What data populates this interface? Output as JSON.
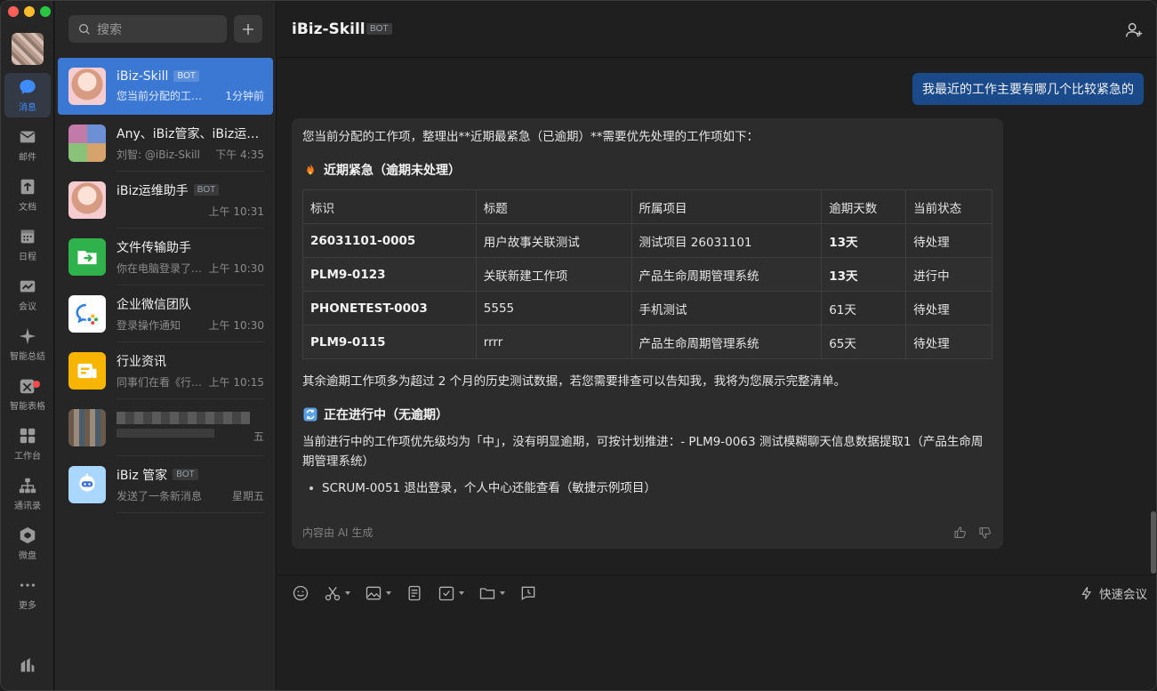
{
  "nav": {
    "items": [
      {
        "label": "消息",
        "icon": "chat-icon"
      },
      {
        "label": "邮件",
        "icon": "mail-icon"
      },
      {
        "label": "文档",
        "icon": "document-icon"
      },
      {
        "label": "日程",
        "icon": "calendar-icon"
      },
      {
        "label": "会议",
        "icon": "meeting-icon"
      },
      {
        "label": "智能总结",
        "icon": "sparkle-icon"
      },
      {
        "label": "智能表格",
        "icon": "smart-table-icon"
      },
      {
        "label": "工作台",
        "icon": "workbench-icon"
      },
      {
        "label": "通讯录",
        "icon": "contacts-icon"
      },
      {
        "label": "微盘",
        "icon": "drive-icon"
      },
      {
        "label": "更多",
        "icon": "more-icon"
      }
    ]
  },
  "search": {
    "placeholder": "搜索"
  },
  "conversations": [
    {
      "name": "iBiz-Skill",
      "badge": "BOT",
      "message": "您当前分配的工作项，整理出**近期最紧急（已逾期）**需要优先处理的工作项如下：",
      "time": "1分钟前",
      "active": true
    },
    {
      "name": "Any、iBiz管家、iBiz运维助手",
      "badge": "",
      "message": "刘智: @iBiz-Skill",
      "time": "下午 4:35"
    },
    {
      "name": "iBiz运维助手",
      "badge": "BOT",
      "message": "",
      "time": "上午 10:31"
    },
    {
      "name": "文件传输助手",
      "badge": "",
      "message": "你在电脑登录了企业微信",
      "time": "上午 10:30"
    },
    {
      "name": "企业微信团队",
      "badge": "",
      "message": "登录操作通知",
      "time": "上午 10:30"
    },
    {
      "name": "行业资讯",
      "badge": "",
      "message": "同事们在看《行业资讯》",
      "time": "上午 10:15"
    },
    {
      "name": "",
      "badge": "",
      "message": "",
      "time": "五"
    },
    {
      "name": "iBiz 管家",
      "badge": "BOT",
      "message": "发送了一条新消息",
      "time": "星期五"
    }
  ],
  "chat": {
    "title": "iBiz-Skill",
    "badge": "BOT",
    "user_message": "我最近的工作主要有哪几个比较紧急的",
    "intro": "您当前分配的工作项，整理出**近期最紧急（已逾期）**需要优先处理的工作项如下：",
    "section1_title": "近期紧急（逾期未处理）",
    "table": {
      "headers": [
        "标识",
        "标题",
        "所属项目",
        "逾期天数",
        "当前状态"
      ],
      "rows": [
        [
          "26031101-0005",
          "用户故事关联测试",
          "测试项目 26031101",
          "13天",
          "待处理"
        ],
        [
          "PLM9-0123",
          "关联新建工作项",
          "产品生命周期管理系统",
          "13天",
          "进行中"
        ],
        [
          "PHONETEST-0003",
          "5555",
          "手机测试",
          "61天",
          "待处理"
        ],
        [
          "PLM9-0115",
          "rrrr",
          "产品生命周期管理系统",
          "65天",
          "待处理"
        ]
      ]
    },
    "remaining_note": "其余逾期工作项多为超过 2 个月的历史测试数据，若您需要排查可以告知我，我将为您展示完整清单。",
    "section2_title": "正在进行中（无逾期）",
    "section2_text": "当前进行中的工作项优先级均为「中」，没有明显逾期，可按计划推进：- PLM9-0063 测试模糊聊天信息数据提取1（产品生命周期管理系统）",
    "section2_bullet": "SCRUM-0051 退出登录，个人中心还能查看（敏捷示例项目）",
    "ai_note": "内容由 AI 生成"
  },
  "composer": {
    "quick_meeting": "快速会议"
  },
  "colors": {
    "accent": "#3b78d4",
    "user_bubble": "#1a4a8a",
    "card_bg": "#2c2c2c"
  }
}
